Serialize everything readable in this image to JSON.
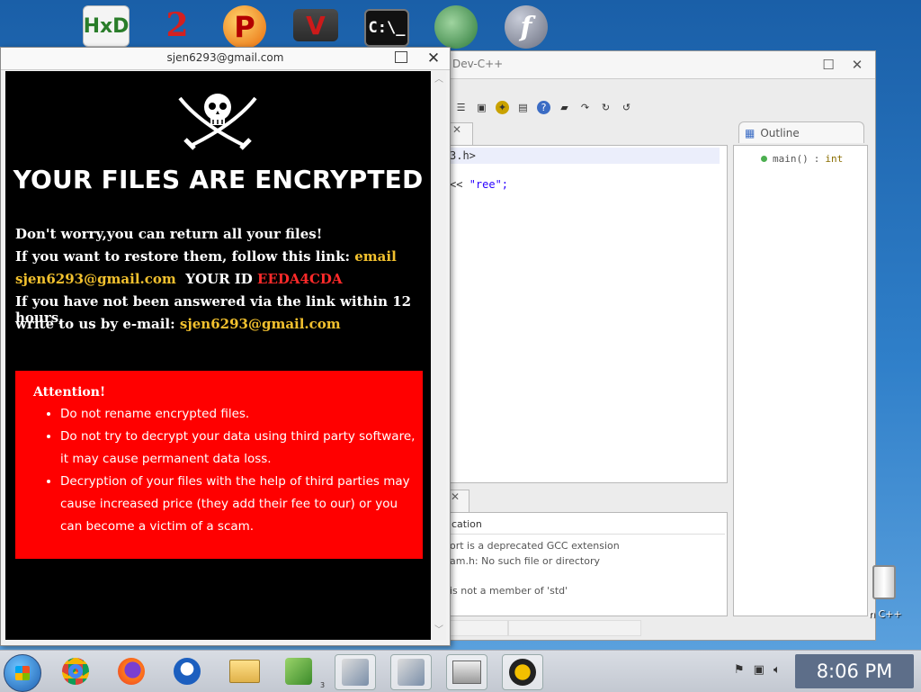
{
  "desktop_icons": [
    {
      "name": "hxd-icon",
      "label": "HxD"
    },
    {
      "name": "two-icon",
      "label": "2"
    },
    {
      "name": "p-icon",
      "label": "P"
    },
    {
      "name": "v-icon",
      "label": "V"
    },
    {
      "name": "cmd-icon",
      "label": "C:\\_"
    },
    {
      "name": "ball-icon",
      "label": ""
    },
    {
      "name": "flash-icon",
      "label": "f"
    }
  ],
  "ransom_window": {
    "title": "sjen6293@gmail.com",
    "headline": "YOUR FILES ARE ENCRYPTED",
    "line1": "Don't worry,you can return all your files!",
    "line2_pre": "If you want to restore them, follow this link: ",
    "line2_link": "email",
    "email": "sjen6293@gmail.com",
    "id_label": "YOUR ID",
    "id_value": "EEDA4CDA",
    "line4": "If you have not been answered via the link within 12 hours,",
    "line5_pre": "write to us by e-mail: ",
    "line5_email": "sjen6293@gmail.com",
    "attention_title": "Attention!",
    "attention_items": [
      "Do not rename encrypted files.",
      "Do not try to decrypt your data using third party software, it may cause permanent data loss.",
      "Decryption of your files with the help of third parties may cause increased price (they add their fee to our) or you can become a victim of a scam."
    ]
  },
  "ide": {
    "title_partial": "Dev-C++",
    "code_line1": "3.h>",
    "code_line2_op": "<< ",
    "code_line2_str": "\"ree\";",
    "outline_tab": "Outline",
    "outline_item_name": "main()",
    "outline_item_sep": " : ",
    "outline_item_type": "int",
    "problems_header": "cation",
    "problems_lines": [
      "ort is a deprecated GCC extension",
      "am.h: No such file or directory",
      "is not a member of 'std'"
    ]
  },
  "recycle_label": "n C++",
  "taskbar": {
    "time": "8:06 PM",
    "badge": "3"
  },
  "colors": {
    "accent_yellow": "#f2c12e",
    "accent_red": "#ff2a2a",
    "attention_bg": "#ff0000"
  }
}
